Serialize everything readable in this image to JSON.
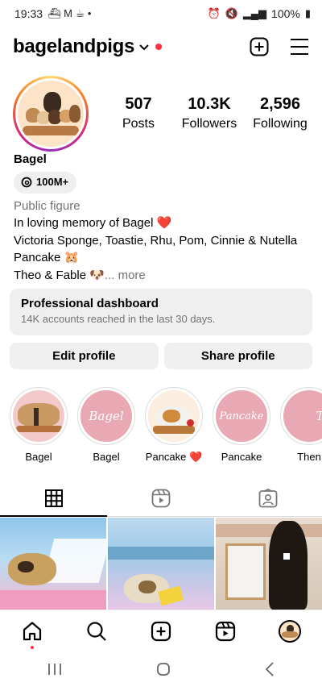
{
  "status_bar": {
    "time": "19:33",
    "battery": "100%"
  },
  "header": {
    "username": "bagelandpigs",
    "icons": [
      "chevron-down-icon",
      "notification-dot",
      "create-plus-icon",
      "menu-icon"
    ]
  },
  "profile": {
    "stats": [
      {
        "value": "507",
        "label": "Posts"
      },
      {
        "value": "10.3K",
        "label": "Followers"
      },
      {
        "value": "2,596",
        "label": "Following"
      }
    ],
    "name": "Bagel",
    "threads_count": "100M+",
    "category": "Public figure",
    "bio_lines": [
      "In loving memory of Bagel ❤️",
      "Victoria Sponge, Toastie, Rhu, Pom, Cinnie & Nutella",
      "Pancake 🐹",
      "Theo & Fable 🐶"
    ],
    "more_label": "... more"
  },
  "dashboard": {
    "title": "Professional dashboard",
    "subtitle": "14K accounts reached in the last 30 days."
  },
  "buttons": {
    "edit": "Edit profile",
    "share": "Share profile"
  },
  "highlights": [
    {
      "label": "Bagel",
      "cover_text": ""
    },
    {
      "label": "Bagel",
      "cover_text": "Bagel"
    },
    {
      "label": "Pancake ❤️",
      "cover_text": ""
    },
    {
      "label": "Pancake",
      "cover_text": "Pancake"
    },
    {
      "label": "Then",
      "cover_text": "Th"
    }
  ],
  "tabs": [
    "grid-icon",
    "reels-icon",
    "tagged-icon"
  ],
  "bottom_nav": [
    "home-icon",
    "search-icon",
    "create-icon",
    "reels-icon",
    "profile-avatar"
  ],
  "colors": {
    "accent_red": "#ff3040",
    "button_bg": "#efefef",
    "muted_text": "#737373"
  }
}
